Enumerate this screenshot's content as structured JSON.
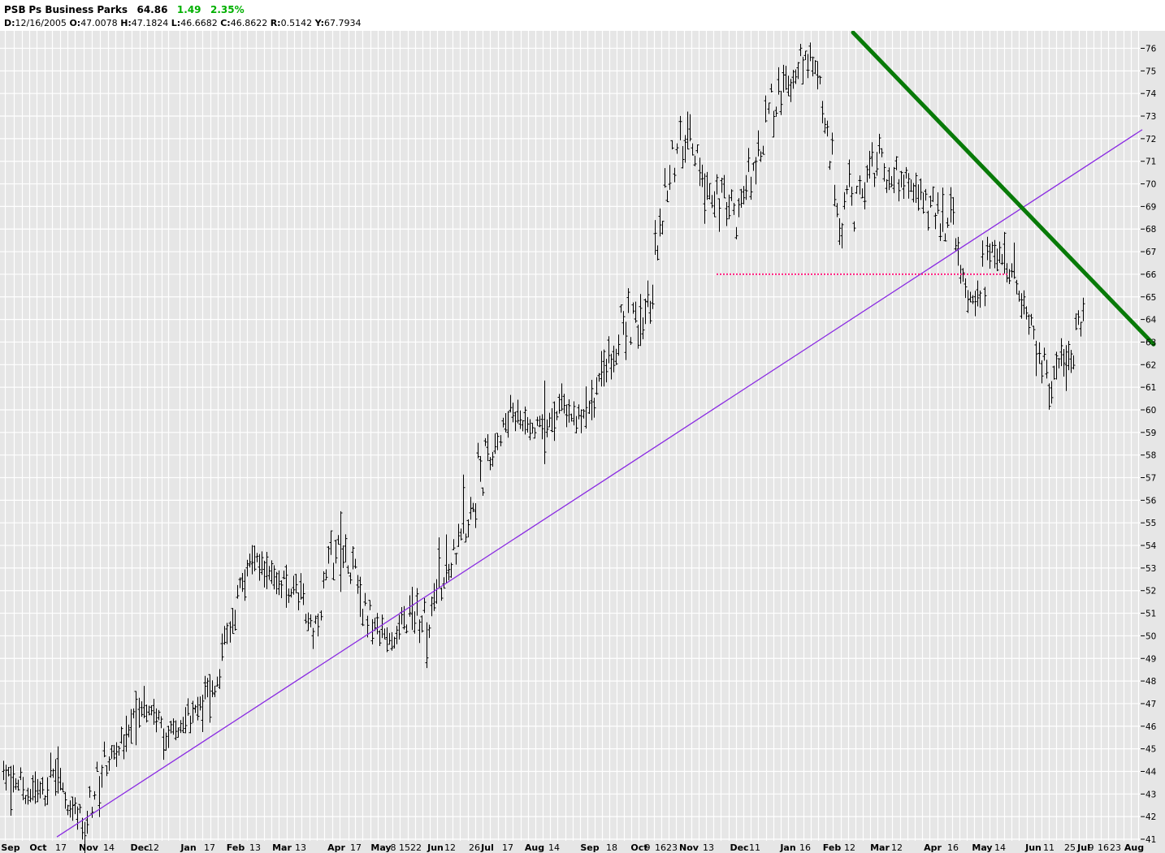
{
  "header": {
    "symbol": "PSB",
    "name": "Ps Business Parks",
    "last": "64.86",
    "change": "1.49",
    "change_pct": "2.35%",
    "ohlc": [
      {
        "label": "D:",
        "value": "12/16/2005"
      },
      {
        "label": "O:",
        "value": "47.0078"
      },
      {
        "label": "H:",
        "value": "47.1824"
      },
      {
        "label": "L:",
        "value": "46.6682"
      },
      {
        "label": "C:",
        "value": "46.8622"
      },
      {
        "label": "R:",
        "value": "0.5142"
      },
      {
        "label": "Y:",
        "value": "67.7934"
      }
    ]
  },
  "colors": {
    "background": "#e6e6e6",
    "grid": "#ffffff",
    "bars": "#000000",
    "change_up": "#00b000",
    "trend_support": "#8a2be2",
    "trend_resistance": "#087a08",
    "support_level": "#ff2080"
  },
  "chart_data": {
    "type": "ohlc-bar",
    "y_axis": {
      "side": "right",
      "range": [
        41,
        76
      ],
      "ticks": [
        "41",
        "42",
        "43",
        "44",
        "45",
        "46",
        "47",
        "48",
        "49",
        "50",
        "51",
        "52",
        "53",
        "54",
        "55",
        "56",
        "57",
        "58",
        "59",
        "60",
        "61",
        "62",
        "63",
        "64",
        "65",
        "66",
        "67",
        "68",
        "69",
        "70",
        "71",
        "72",
        "73",
        "74",
        "75",
        "76"
      ]
    },
    "x_axis": {
      "labels": [
        {
          "text": "Sep"
        },
        {
          "text": "Oct"
        },
        {
          "text": "17"
        },
        {
          "text": "Nov"
        },
        {
          "text": "14"
        },
        {
          "text": "Dec"
        },
        {
          "text": "12"
        },
        {
          "text": "Jan"
        },
        {
          "text": "17"
        },
        {
          "text": "Feb"
        },
        {
          "text": "13"
        },
        {
          "text": "Mar"
        },
        {
          "text": "13"
        },
        {
          "text": "Apr"
        },
        {
          "text": "17"
        },
        {
          "text": "May"
        },
        {
          "text": "8"
        },
        {
          "text": "15"
        },
        {
          "text": "22"
        },
        {
          "text": "Jun"
        },
        {
          "text": "12"
        },
        {
          "text": "26"
        },
        {
          "text": "Jul"
        },
        {
          "text": "17"
        },
        {
          "text": "Aug"
        },
        {
          "text": "14"
        },
        {
          "text": "Sep"
        },
        {
          "text": "18"
        },
        {
          "text": "Oct"
        },
        {
          "text": "9"
        },
        {
          "text": "16"
        },
        {
          "text": "23"
        },
        {
          "text": "Nov"
        },
        {
          "text": "13"
        },
        {
          "text": "Dec"
        },
        {
          "text": "11"
        },
        {
          "text": "Jan"
        },
        {
          "text": "16"
        },
        {
          "text": "Feb"
        },
        {
          "text": "12"
        },
        {
          "text": "Mar"
        },
        {
          "text": "12"
        },
        {
          "text": "Apr"
        },
        {
          "text": "16"
        },
        {
          "text": "May"
        },
        {
          "text": "14"
        },
        {
          "text": "Jun"
        },
        {
          "text": "11"
        },
        {
          "text": "25"
        },
        {
          "text": "Jul"
        },
        {
          "text": "9"
        },
        {
          "text": "16"
        },
        {
          "text": "23"
        },
        {
          "text": "Aug"
        }
      ]
    },
    "price_path": [
      [
        43.8,
        44.3
      ],
      [
        43.0,
        44.0
      ],
      [
        42.0,
        43.5
      ],
      [
        43.2,
        44.7
      ],
      [
        41.8,
        42.6
      ],
      [
        41.1,
        42.8
      ],
      [
        43.4,
        45.0
      ],
      [
        44.5,
        45.3
      ],
      [
        46.0,
        47.0
      ],
      [
        46.5,
        47.2
      ],
      [
        45.2,
        45.9
      ],
      [
        45.5,
        46.4
      ],
      [
        46.3,
        47.3
      ],
      [
        47.3,
        48.6
      ],
      [
        50.2,
        51.5
      ],
      [
        53.0,
        54.0
      ],
      [
        52.5,
        53.2
      ],
      [
        51.9,
        52.8
      ],
      [
        51.4,
        52.5
      ],
      [
        49.5,
        51.0
      ],
      [
        52.8,
        54.3
      ],
      [
        53.0,
        54.5
      ],
      [
        50.6,
        52.0
      ],
      [
        49.8,
        50.5
      ],
      [
        49.6,
        50.3
      ],
      [
        50.3,
        52.0
      ],
      [
        50.0,
        51.5
      ],
      [
        52.2,
        53.4
      ],
      [
        53.8,
        54.7
      ],
      [
        55.5,
        58.3
      ],
      [
        57.6,
        59.2
      ],
      [
        58.2,
        61.5
      ],
      [
        59.1,
        60.0
      ],
      [
        58.8,
        59.4
      ],
      [
        59.9,
        60.7
      ],
      [
        59.3,
        60.0
      ],
      [
        59.6,
        60.5
      ],
      [
        61.5,
        63.5
      ],
      [
        63.0,
        65.0
      ],
      [
        62.7,
        64.2
      ],
      [
        66.0,
        68.5
      ],
      [
        69.0,
        73.5
      ],
      [
        71.5,
        72.8
      ],
      [
        69.5,
        71.0
      ],
      [
        68.5,
        70.5
      ],
      [
        67.5,
        69.5
      ],
      [
        70.5,
        72.5
      ],
      [
        72.5,
        74.5
      ],
      [
        74.0,
        75.7
      ],
      [
        75.0,
        76.4
      ],
      [
        73.5,
        75.0
      ],
      [
        66.2,
        71.0
      ],
      [
        68.0,
        70.5
      ],
      [
        70.0,
        72.5
      ],
      [
        69.5,
        71.5
      ],
      [
        69.5,
        70.8
      ],
      [
        68.5,
        70.0
      ],
      [
        68.0,
        69.5
      ],
      [
        67.2,
        69.0
      ],
      [
        64.5,
        66.0
      ],
      [
        65.0,
        67.5
      ],
      [
        66.5,
        68.0
      ],
      [
        64.5,
        66.0
      ],
      [
        62.0,
        64.5
      ],
      [
        60.3,
        61.5
      ],
      [
        61.0,
        63.5
      ],
      [
        63.5,
        64.9
      ]
    ],
    "annotations": [
      {
        "kind": "trendline",
        "name": "rising-support",
        "from": {
          "x": 0,
          "y": 41.1
        },
        "to": {
          "x": 1,
          "y": 72.4
        }
      },
      {
        "kind": "trendline",
        "name": "falling-resistance",
        "from": {
          "x": 0,
          "y": 76.7
        },
        "to": {
          "x": 1,
          "y": 62.9
        }
      },
      {
        "kind": "hline",
        "name": "support-level",
        "y": 66.0
      }
    ]
  }
}
